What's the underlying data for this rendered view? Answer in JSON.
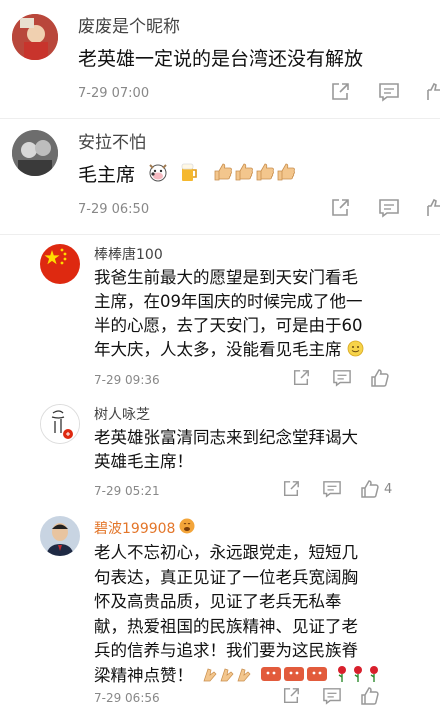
{
  "comments": [
    {
      "username": "废废是个昵称",
      "text": "老英雄一定说的是台湾还没有解放",
      "time": "7-29 07:00"
    },
    {
      "username": "安拉不怕",
      "text": "毛主席",
      "time": "7-29 06:50"
    }
  ],
  "replies": [
    {
      "username": "棒棒唐100",
      "lines": [
        "我爸生前最大的愿望是到天安门看毛",
        "主席，在09年国庆的时候完成了他一",
        "半的心愿，去了天安门，可是由于60",
        "年大庆，人太多，没能看见毛主席"
      ],
      "time": "7-29 09:36"
    },
    {
      "username": "树人咏芝",
      "lines": [
        "老英雄张富清同志来到纪念堂拜谒大",
        "英雄毛主席！"
      ],
      "time": "7-29 05:21",
      "likes": "4"
    },
    {
      "username": "碧波199908",
      "lines": [
        "老人不忘初心，永远跟党走，短短几",
        "句表达，真正见证了一位老兵宽阔胸",
        "怀及高贵品质，见证了老兵无私奉",
        "献，热爱祖国的民族精神、见证了老",
        "兵的信养与追求！我们要为这民族脊",
        "梁精神点赞！"
      ],
      "time": "7-29 06:56"
    }
  ],
  "colors": {
    "meta": "#888888",
    "icon": "#999999",
    "flag": "#de2910"
  },
  "icons": [
    "share-icon",
    "comment-icon",
    "like-icon",
    "more-icon",
    "cow-emoji",
    "beer-emoji",
    "thumbs-up-emoji",
    "smile-emoji",
    "clap-emoji",
    "hug-emoji",
    "rose-emoji",
    "fire-emoji"
  ]
}
